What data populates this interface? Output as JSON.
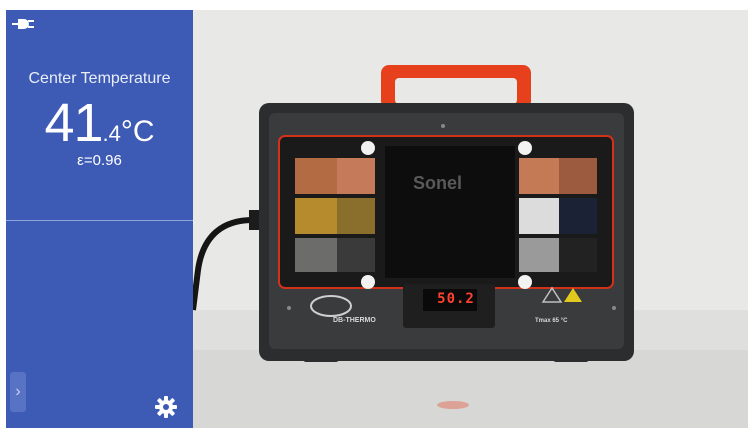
{
  "sidebar": {
    "title": "Center Temperature",
    "temperature_int": "41",
    "temperature_dec": ".4",
    "temperature_unit": "°C",
    "emissivity": "ε=0.96",
    "icons": {
      "power": "power-plug-icon",
      "expand": "chevron-right-icon",
      "settings": "gear-icon"
    },
    "expand_label": "›"
  },
  "camera_view": {
    "display_reading": "50.2",
    "brand": "Sonel",
    "model": "DB-THERMO",
    "tmax": "Tmax 65 °C"
  },
  "colors": {
    "sidebar_bg": "#3d5bb5",
    "display_red": "#ff4230",
    "case_frame": "#2b2d2e",
    "handle": "#e6401d"
  }
}
